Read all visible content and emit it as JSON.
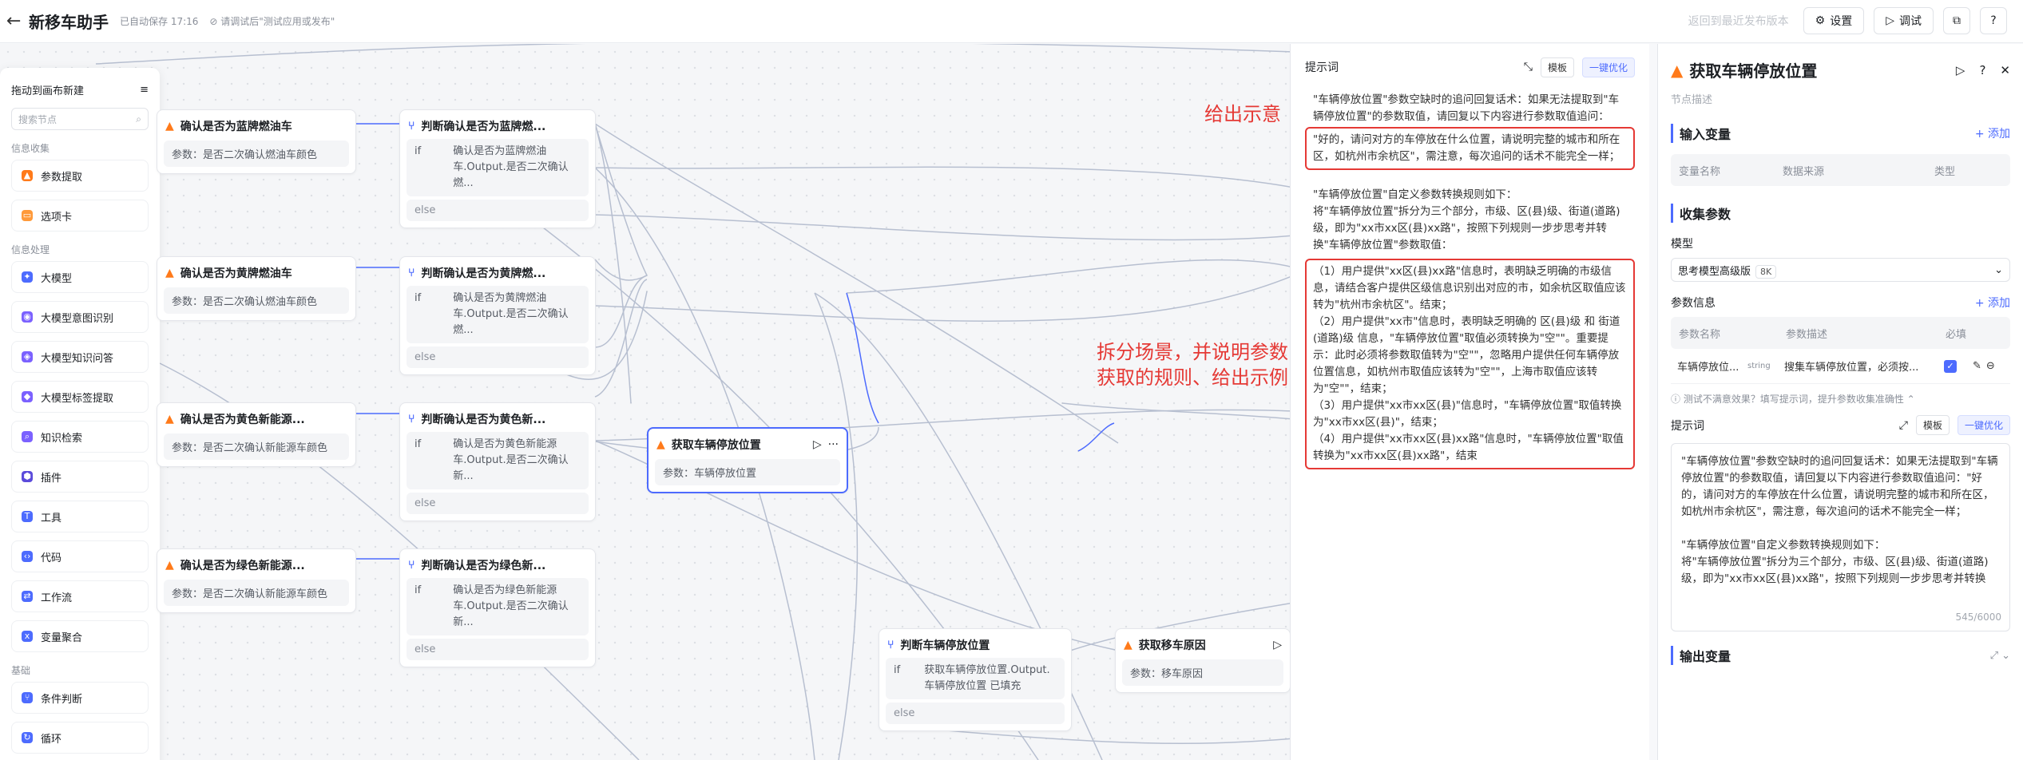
{
  "topbar": {
    "title": "新移车助手",
    "saved": "已自动保存 17:16",
    "hint": "请调试后\"测试应用或发布\"",
    "revert": "返回到最近发布版本",
    "settings": "设置",
    "debug": "调试"
  },
  "sidebar": {
    "header": "拖动到画布新建",
    "search_placeholder": "搜索节点",
    "sections": [
      {
        "label": "信息收集",
        "items": [
          "参数提取",
          "选项卡"
        ]
      },
      {
        "label": "信息处理",
        "items": [
          "大模型",
          "大模型意图识别",
          "大模型知识问答",
          "大模型标签提取",
          "知识检索",
          "插件",
          "工具",
          "代码",
          "工作流",
          "变量聚合"
        ]
      },
      {
        "label": "基础",
        "items": [
          "条件判断",
          "循环"
        ]
      }
    ]
  },
  "nodes": {
    "n1": {
      "title": "确认是否为蓝牌燃油车",
      "param": "参数：是否二次确认燃油车颜色"
    },
    "n2": {
      "title": "确认是否为黄牌燃油车",
      "param": "参数：是否二次确认燃油车颜色"
    },
    "n3": {
      "title": "确认是否为黄色新能源...",
      "param": "参数：是否二次确认新能源车颜色"
    },
    "n4": {
      "title": "确认是否为绿色新能源...",
      "param": "参数：是否二次确认新能源车颜色"
    },
    "c1": {
      "title": "判断确认是否为蓝牌燃...",
      "if": "if",
      "cond": "确认是否为蓝牌燃油车.Output.是否二次确认燃...",
      "else": "else"
    },
    "c2": {
      "title": "判断确认是否为黄牌燃...",
      "if": "if",
      "cond": "确认是否为黄牌燃油车.Output.是否二次确认燃...",
      "else": "else"
    },
    "c3": {
      "title": "判断确认是否为黄色新...",
      "if": "if",
      "cond": "确认是否为黄色新能源车.Output.是否二次确认新...",
      "else": "else"
    },
    "c4": {
      "title": "判断确认是否为绿色新...",
      "if": "if",
      "cond": "确认是否为绿色新能源车.Output.是否二次确认新...",
      "else": "else"
    },
    "main": {
      "title": "获取车辆停放位置",
      "param": "参数：车辆停放位置"
    },
    "judge": {
      "title": "判断车辆停放位置",
      "if": "if",
      "cond": "获取车辆停放位置.Output.车辆停放位置 已填充",
      "else": "else"
    },
    "reason": {
      "title": "获取移车原因",
      "param": "参数：移车原因"
    }
  },
  "prompt_panel": {
    "title": "提示词",
    "template": "模板",
    "optimize": "一键优化",
    "p1": "\"车辆停放位置\"参数空缺时的追问回复话术：如果无法提取到\"车辆停放位置\"的参数取值，请回复以下内容进行参数取值追问：",
    "p1_box": "\"好的，请问对方的车停放在什么位置，请说明完整的城市和所在区，如杭州市余杭区\"，需注意，每次追问的话术不能完全一样；",
    "p2": "\"车辆停放位置\"自定义参数转换规则如下：",
    "p3": "将\"车辆停放位置\"拆分为三个部分，市级、区(县)级、街道(道路)级，即为\"xx市xx区(县)xx路\"，按照下列规则一步步思考并转换\"车辆停放位置\"参数取值：",
    "r1": "（1）用户提供\"xx区(县)xx路\"信息时，表明缺乏明确的市级信息，请结合客户提供区级信息识别出对应的市，如余杭区取值应该转为\"杭州市余杭区\"。结束；",
    "r2": "（2）用户提供\"xx市\"信息时，表明缺乏明确的 区(县)级 和 街道(道路)级 信息，\"车辆停放位置\"取值必须转换为\"空\"\"。重要提示：此时必须将参数取值转为\"空\"\"，忽略用户提供任何车辆停放位置信息，如杭州市取值应该转为\"空\"\"，上海市取值应该转为\"空\"\"，结束；",
    "r3": "（3）用户提供\"xx市xx区(县)\"信息时，\"车辆停放位置\"取值转换为\"xx市xx区(县)\"，结束；",
    "r4": "（4）用户提供\"xx市xx区(县)xx路\"信息时，\"车辆停放位置\"取值转换为\"xx市xx区(县)xx路\"，结束"
  },
  "annotations": {
    "a1": "给出示意",
    "a2_l1": "拆分场景，并说明参数",
    "a2_l2": "获取的规则、给出示例"
  },
  "config": {
    "title": "获取车辆停放位置",
    "desc": "节点描述",
    "input_title": "输入变量",
    "add": "添加",
    "input_cols": [
      "变量名称",
      "数据来源",
      "类型"
    ],
    "collect_title": "收集参数",
    "model_label": "模型",
    "model_value": "思考模型高级版",
    "model_badge": "8K",
    "param_info": "参数信息",
    "param_cols": [
      "参数名称",
      "参数描述",
      "必填"
    ],
    "param_name": "车辆停放位...",
    "param_type": "string",
    "param_desc": "搜集车辆停放位置，必须按...",
    "tip": "测试不满意效果？填写提示词，提升参数收集准确性",
    "prompt_label": "提示词",
    "template": "模板",
    "optimize": "一键优化",
    "prompt_p1": "\"车辆停放位置\"参数空缺时的追问回复话术：如果无法提取到\"车辆停放位置\"的参数取值，请回复以下内容进行参数取值追问：\"好的，请问对方的车停放在什么位置，请说明完整的城市和所在区，如杭州市余杭区\"，需注意，每次追问的话术不能完全一样；",
    "prompt_p2": "\"车辆停放位置\"自定义参数转换规则如下：",
    "prompt_p3": "将\"车辆停放位置\"拆分为三个部分，市级、区(县)级、街道(道路)级，即为\"xx市xx区(县)xx路\"，按照下列规则一步步思考并转换",
    "count": "545/6000",
    "output_title": "输出变量"
  }
}
